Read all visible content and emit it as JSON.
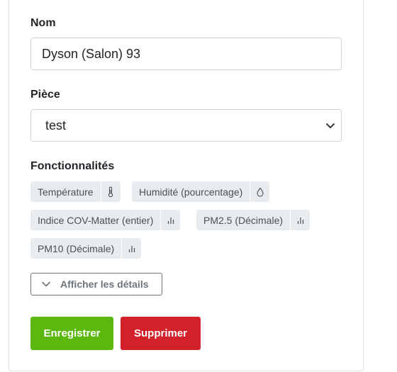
{
  "form": {
    "name_label": "Nom",
    "name_value": "Dyson (Salon) 93",
    "room_label": "Pièce",
    "room_value": "test",
    "features_label": "Fonctionnalités",
    "features": [
      {
        "label": "Température",
        "icon": "thermometer-icon"
      },
      {
        "label": "Humidité (pourcentage)",
        "icon": "droplet-icon"
      },
      {
        "label": "Indice COV-Matter (entier)",
        "icon": "bar-chart-icon"
      },
      {
        "label": "PM2.5 (Décimale)",
        "icon": "bar-chart-icon"
      },
      {
        "label": "PM10 (Décimale)",
        "icon": "bar-chart-icon"
      }
    ],
    "details_label": "Afficher les détails",
    "save_label": "Enregistrer",
    "delete_label": "Supprimer"
  },
  "colors": {
    "save": "#5cb70f",
    "delete": "#d3212b",
    "tag_bg": "#e9ecef",
    "border": "#ced4da"
  }
}
